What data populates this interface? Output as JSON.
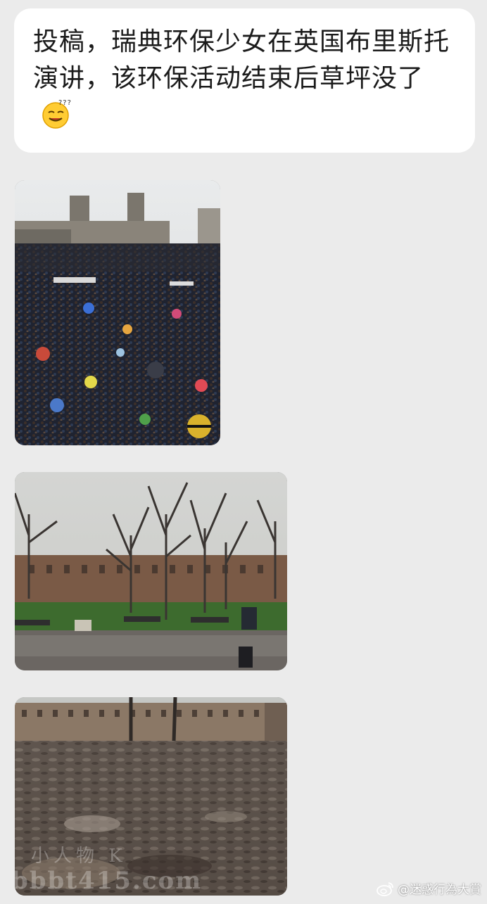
{
  "message": {
    "text": "投稿，瑞典环保少女在英国布里斯托演讲，该环保活动结束后草坪没了",
    "emoji": "dizzy-smile-emoji"
  },
  "images": [
    {
      "name": "crowd-photo",
      "icon": "crowd-rally-image"
    },
    {
      "name": "park-photo",
      "icon": "park-lawn-image"
    },
    {
      "name": "mud-photo",
      "icon": "muddy-ground-image"
    }
  ],
  "photo_watermark": {
    "line1": "小人物 K",
    "line2": "bbbt415.com"
  },
  "weibo_watermark": {
    "text": "@迷惑行為大賞",
    "icon": "weibo-logo-icon"
  },
  "colors": {
    "background": "#ebebeb",
    "bubble": "#ffffff",
    "text": "#1b1b1b"
  }
}
